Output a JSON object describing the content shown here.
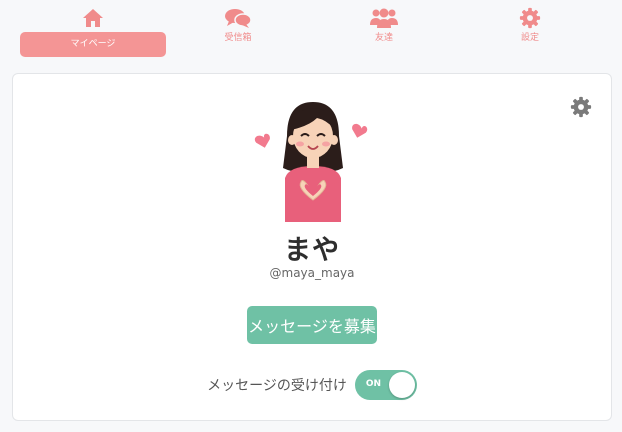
{
  "tabs": {
    "mypage": {
      "label": "マイページ",
      "icon": "home-icon",
      "active": true
    },
    "inbox": {
      "label": "受信箱",
      "icon": "chat-bubbles-icon"
    },
    "friends": {
      "label": "友達",
      "icon": "users-icon"
    },
    "settings": {
      "label": "設定",
      "icon": "gear-icon"
    }
  },
  "profile": {
    "name": "まや",
    "handle": "@maya_maya",
    "avatar": "girl-heart-hands-avatar",
    "settings_icon": "gear-icon"
  },
  "actions": {
    "recruit_label": "メッセージを募集"
  },
  "receive_toggle": {
    "label": "メッセージの受け付け",
    "state": "ON",
    "on": true
  },
  "colors": {
    "accent_pink": "#f49595",
    "accent_green": "#6fc1a5",
    "tab_text": "#f08b8b"
  }
}
